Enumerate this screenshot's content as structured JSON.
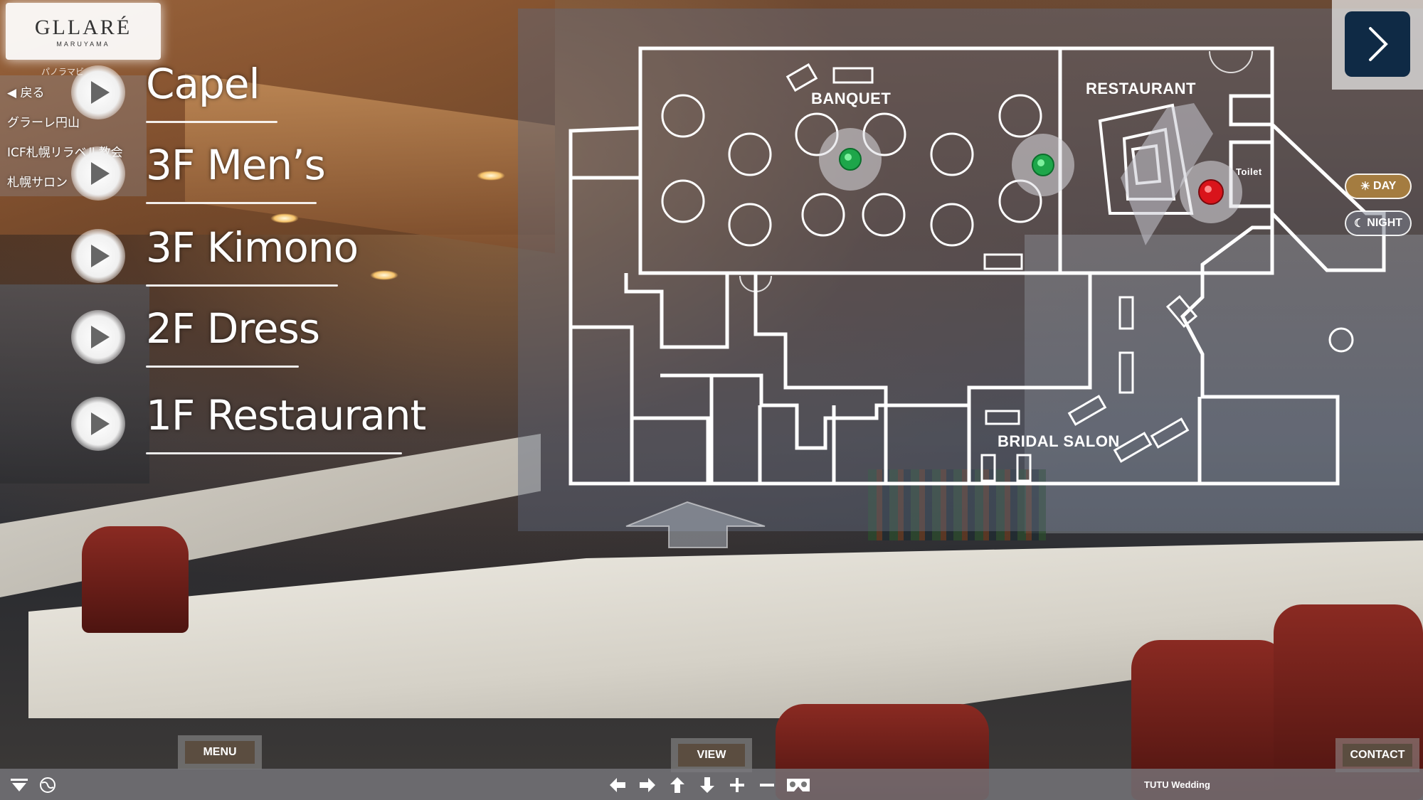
{
  "logo": {
    "name": "GLLARÉ",
    "sub": "MARUYAMA",
    "caption": "パノラマビ"
  },
  "site_menu": {
    "items": [
      {
        "label": "◀ 戻る"
      },
      {
        "label": "グラーレ円山"
      },
      {
        "label": "ICF札幌リラベル教会"
      },
      {
        "label": "札幌サロン"
      }
    ]
  },
  "floors": [
    {
      "label": "Capel"
    },
    {
      "label": "3F Men’s"
    },
    {
      "label": "3F Kimono"
    },
    {
      "label": "2F Dress"
    },
    {
      "label": "1F Restaurant"
    }
  ],
  "map": {
    "labels": {
      "banquet": "BANQUET",
      "restaurant": "RESTAURANT",
      "toilet": "Toilet",
      "bridal_salon": "BRIDAL SALON"
    },
    "hotspot_colors": {
      "green": "#1ea64a",
      "red": "#d9141b"
    }
  },
  "day_night": {
    "day": "DAY",
    "night": "NIGHT"
  },
  "bottom": {
    "menu": "MENU",
    "view": "VIEW",
    "contact": "CONTACT",
    "brand": "TUTU Wedding"
  },
  "colors": {
    "next_button": "#0f2a45",
    "tab_inner": "#5b4d40"
  }
}
